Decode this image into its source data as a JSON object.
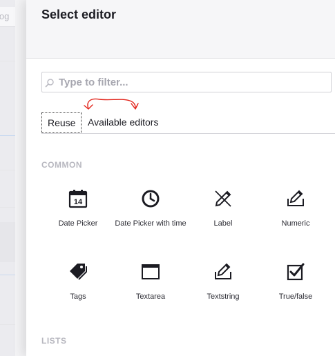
{
  "background": {
    "tab_fragment": "log"
  },
  "panel": {
    "title": "Select editor"
  },
  "search": {
    "placeholder": "Type to filter..."
  },
  "tabs": [
    {
      "label": "Reuse"
    },
    {
      "label": "Available editors"
    }
  ],
  "sections": {
    "common_title": "COMMON",
    "lists_title": "LISTS"
  },
  "editors": [
    {
      "label": "Date Picker",
      "icon": "calendar-icon"
    },
    {
      "label": "Date Picker with time",
      "icon": "clock-icon"
    },
    {
      "label": "Label",
      "icon": "pen-icon"
    },
    {
      "label": "Numeric",
      "icon": "edit-box-icon"
    },
    {
      "label": "Tags",
      "icon": "tags-icon"
    },
    {
      "label": "Textarea",
      "icon": "window-icon"
    },
    {
      "label": "Textstring",
      "icon": "edit-box-icon"
    },
    {
      "label": "True/false",
      "icon": "checkbox-icon"
    }
  ],
  "colors": {
    "annotation": "#e2231a",
    "header_bg": "#f6f6f8",
    "section_title": "#b7b7bf"
  }
}
